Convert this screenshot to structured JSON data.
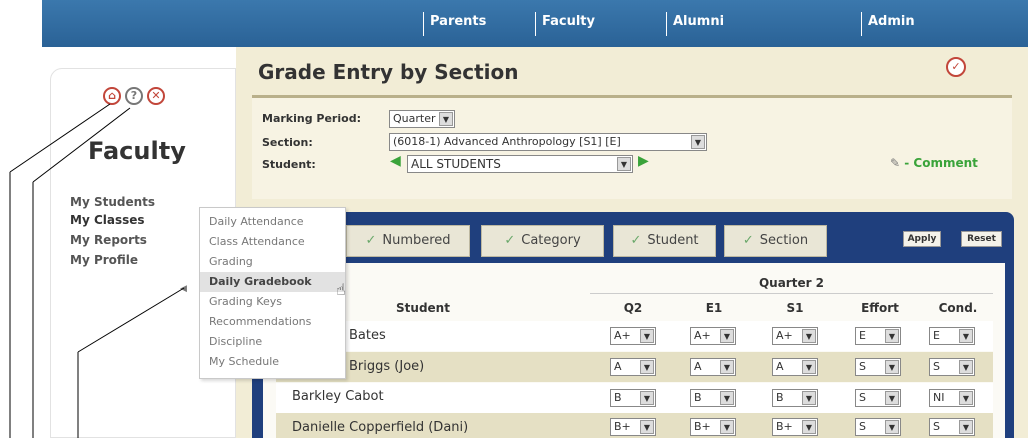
{
  "topnav": {
    "items": [
      "Parents",
      "Faculty",
      "Alumni",
      "Admin"
    ]
  },
  "left": {
    "title": "Faculty",
    "nav": [
      "My Students",
      "My Classes",
      "My Reports",
      "My Profile"
    ],
    "icons": [
      "home-icon",
      "help-icon",
      "close-icon"
    ]
  },
  "submenu": {
    "items": [
      "Daily Attendance",
      "Class Attendance",
      "Grading",
      "Daily Gradebook",
      "Grading Keys",
      "Recommendations",
      "Discipline",
      "My Schedule"
    ],
    "highlighted": "Daily Gradebook"
  },
  "main": {
    "title": "Grade Entry by Section",
    "marking_period_label": "Marking Period:",
    "marking_period_value": "Quarter 2",
    "section_label": "Section:",
    "section_value": "(6018-1) Advanced Anthropology [S1] [E]",
    "student_label": "Student:",
    "student_value": "ALL STUDENTS",
    "comment_label": "- Comment"
  },
  "tabs": [
    "Numbered",
    "Category",
    "Student",
    "Section"
  ],
  "buttons": {
    "apply": "Apply",
    "reset": "Reset"
  },
  "table": {
    "group_header": "Quarter 2",
    "columns": [
      "Student",
      "Q2",
      "E1",
      "S1",
      "Effort",
      "Cond."
    ],
    "rows": [
      {
        "name": "Bates",
        "grades": [
          "A+",
          "A+",
          "A+",
          "E",
          "E"
        ]
      },
      {
        "name": "Briggs (Joe)",
        "grades": [
          "A",
          "A",
          "A",
          "S",
          "S"
        ]
      },
      {
        "name": "Barkley Cabot",
        "grades": [
          "B",
          "B",
          "B",
          "S",
          "NI"
        ]
      },
      {
        "name": "Danielle Copperfield (Dani)",
        "grades": [
          "B+",
          "B+",
          "B+",
          "S",
          "S"
        ]
      }
    ]
  },
  "colors": {
    "nav_blue": "#2a6296",
    "panel_blue": "#1f3f7d",
    "tan": "#f2edd6",
    "accent_red": "#c2463a",
    "green": "#3aa33a"
  }
}
